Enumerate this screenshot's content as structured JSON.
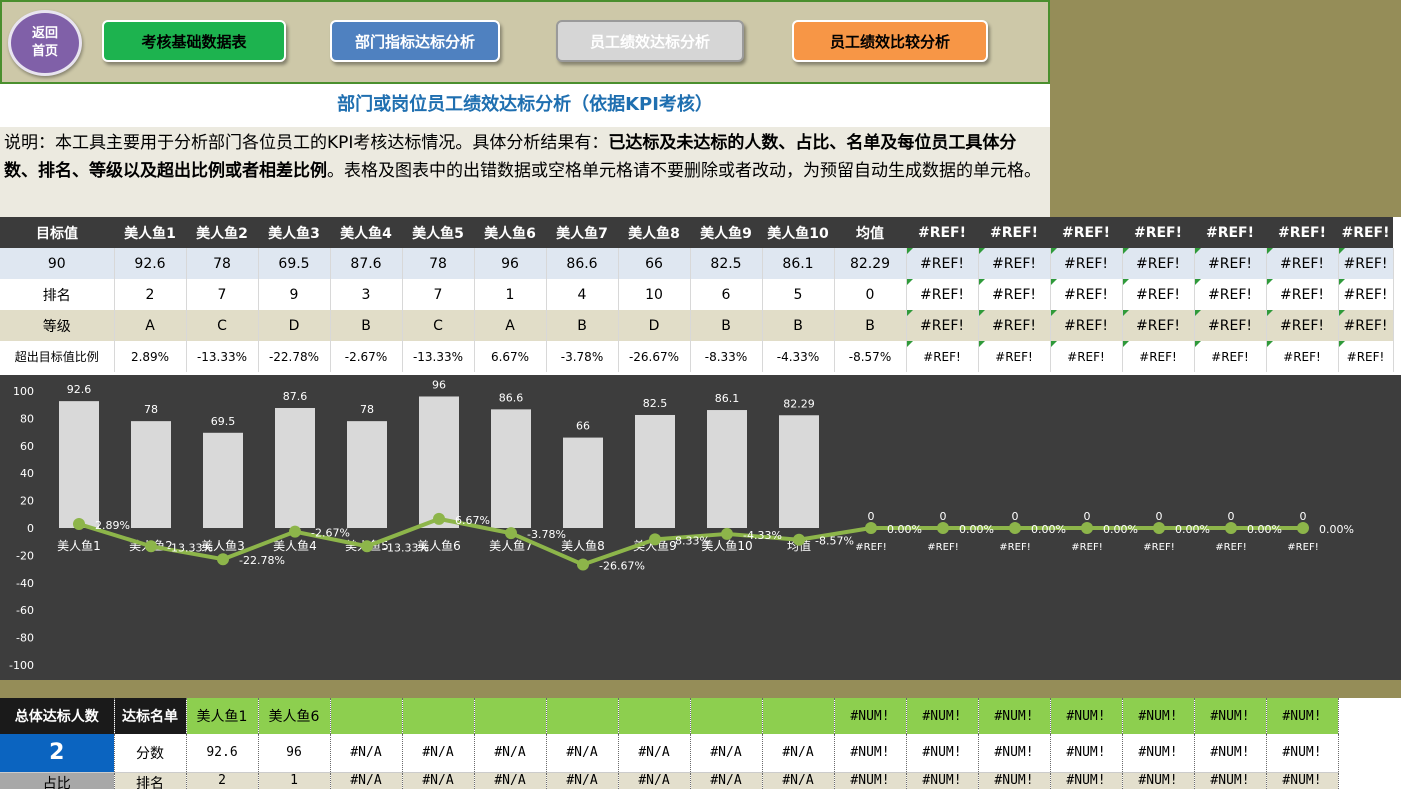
{
  "nav": {
    "home_line1": "返回",
    "home_line2": "首页",
    "buttons": [
      {
        "label": "考核基础数据表",
        "color": "#1db34f"
      },
      {
        "label": "部门指标达标分析",
        "color": "#4f81c0"
      },
      {
        "label": "员工绩效达标分析",
        "color": "#d6d6d6",
        "text_color": "#ffffff"
      },
      {
        "label": "员工绩效比较分析",
        "color": "#f79646"
      }
    ]
  },
  "title": "部门或岗位员工绩效达标分析（依据KPI考核）",
  "description": {
    "part1": "说明：本工具主要用于分析部门各位员工的KPI考核达标情况。具体分析结果有：",
    "bold": "已达标及未达标的人数、占比、名单及每位员工具体分数、排名、等级以及超出比例或者相差比例",
    "part2": "。表格及图表中的出错数据或空格单元格请不要删除或者改动，为预留自动生成数据的单元格。"
  },
  "table": {
    "header": [
      "目标值",
      "美人鱼1",
      "美人鱼2",
      "美人鱼3",
      "美人鱼4",
      "美人鱼5",
      "美人鱼6",
      "美人鱼7",
      "美人鱼8",
      "美人鱼9",
      "美人鱼10",
      "均值",
      "#REF!",
      "#REF!",
      "#REF!",
      "#REF!",
      "#REF!",
      "#REF!",
      "#REF!"
    ],
    "values": [
      "90",
      "92.6",
      "78",
      "69.5",
      "87.6",
      "78",
      "96",
      "86.6",
      "66",
      "82.5",
      "86.1",
      "82.29",
      "#REF!",
      "#REF!",
      "#REF!",
      "#REF!",
      "#REF!",
      "#REF!",
      "#REF!"
    ],
    "rank": [
      "排名",
      "2",
      "7",
      "9",
      "3",
      "7",
      "1",
      "4",
      "10",
      "6",
      "5",
      "0",
      "#REF!",
      "#REF!",
      "#REF!",
      "#REF!",
      "#REF!",
      "#REF!",
      "#REF!"
    ],
    "grade": [
      "等级",
      "A",
      "C",
      "D",
      "B",
      "C",
      "A",
      "B",
      "D",
      "B",
      "B",
      "B",
      "#REF!",
      "#REF!",
      "#REF!",
      "#REF!",
      "#REF!",
      "#REF!",
      "#REF!"
    ],
    "pct": [
      "超出目标值比例",
      "2.89%",
      "-13.33%",
      "-22.78%",
      "-2.67%",
      "-13.33%",
      "6.67%",
      "-3.78%",
      "-26.67%",
      "-8.33%",
      "-4.33%",
      "-8.57%",
      "#REF!",
      "#REF!",
      "#REF!",
      "#REF!",
      "#REF!",
      "#REF!",
      "#REF!"
    ]
  },
  "chart_data": {
    "type": "bar",
    "categories": [
      "美人鱼1",
      "美人鱼2",
      "美人鱼3",
      "美人鱼4",
      "美人鱼5",
      "美人鱼6",
      "美人鱼7",
      "美人鱼8",
      "美人鱼9",
      "美人鱼10",
      "均值",
      "#REF!",
      "#REF!",
      "#REF!",
      "#REF!",
      "#REF!",
      "#REF!",
      "#REF!"
    ],
    "series": [
      {
        "type": "bar",
        "values": [
          92.6,
          78,
          69.5,
          87.6,
          78,
          96,
          86.6,
          66,
          82.5,
          86.1,
          82.29,
          0,
          0,
          0,
          0,
          0,
          0,
          0
        ],
        "labels": [
          "92.6",
          "78",
          "69.5",
          "87.6",
          "78",
          "96",
          "86.6",
          "66",
          "82.5",
          "86.1",
          "82.29",
          "0",
          "0",
          "0",
          "0",
          "0",
          "0",
          "0"
        ]
      },
      {
        "type": "line",
        "values": [
          2.89,
          -13.33,
          -22.78,
          -2.67,
          -13.33,
          6.67,
          -3.78,
          -26.67,
          -8.33,
          -4.33,
          -8.57,
          0,
          0,
          0,
          0,
          0,
          0,
          0
        ],
        "labels": [
          "2.89%",
          "-13.33%",
          "-22.78%",
          "-2.67%",
          "-13.33%",
          "6.67%",
          "-3.78%",
          "-26.67%",
          "-8.33%",
          "-4.33%",
          "-8.57%",
          "0.00%",
          "0.00%",
          "0.00%",
          "0.00%",
          "0.00%",
          "0.00%",
          "0.00%"
        ]
      }
    ],
    "ylim": [
      -100,
      100
    ],
    "yticks": [
      "100",
      "80",
      "60",
      "40",
      "20",
      "0",
      "-20",
      "-40",
      "-60",
      "-80",
      "-100"
    ],
    "colors": {
      "bar": "#d9d9d9",
      "line": "#8db54a",
      "background": "#3d3d3d",
      "text": "#ffffff"
    }
  },
  "bottom": {
    "total_label": "总体达标人数",
    "list_label": "达标名单",
    "names": [
      "美人鱼1",
      "美人鱼6",
      "",
      "",
      "",
      "",
      "",
      "",
      "",
      "#NUM!",
      "#NUM!",
      "#NUM!",
      "#NUM!",
      "#NUM!",
      "#NUM!",
      "#NUM!"
    ],
    "count": "2",
    "score_label": "分数",
    "scores": [
      "92.6",
      "96",
      "#N/A",
      "#N/A",
      "#N/A",
      "#N/A",
      "#N/A",
      "#N/A",
      "#N/A",
      "#NUM!",
      "#NUM!",
      "#NUM!",
      "#NUM!",
      "#NUM!",
      "#NUM!",
      "#NUM!"
    ],
    "ratio_label": "占比",
    "rank_label": "排名",
    "ranks": [
      "2",
      "1",
      "#N/A",
      "#N/A",
      "#N/A",
      "#N/A",
      "#N/A",
      "#N/A",
      "#N/A",
      "#NUM!",
      "#NUM!",
      "#NUM!",
      "#NUM!",
      "#NUM!",
      "#NUM!",
      "#NUM!"
    ]
  }
}
